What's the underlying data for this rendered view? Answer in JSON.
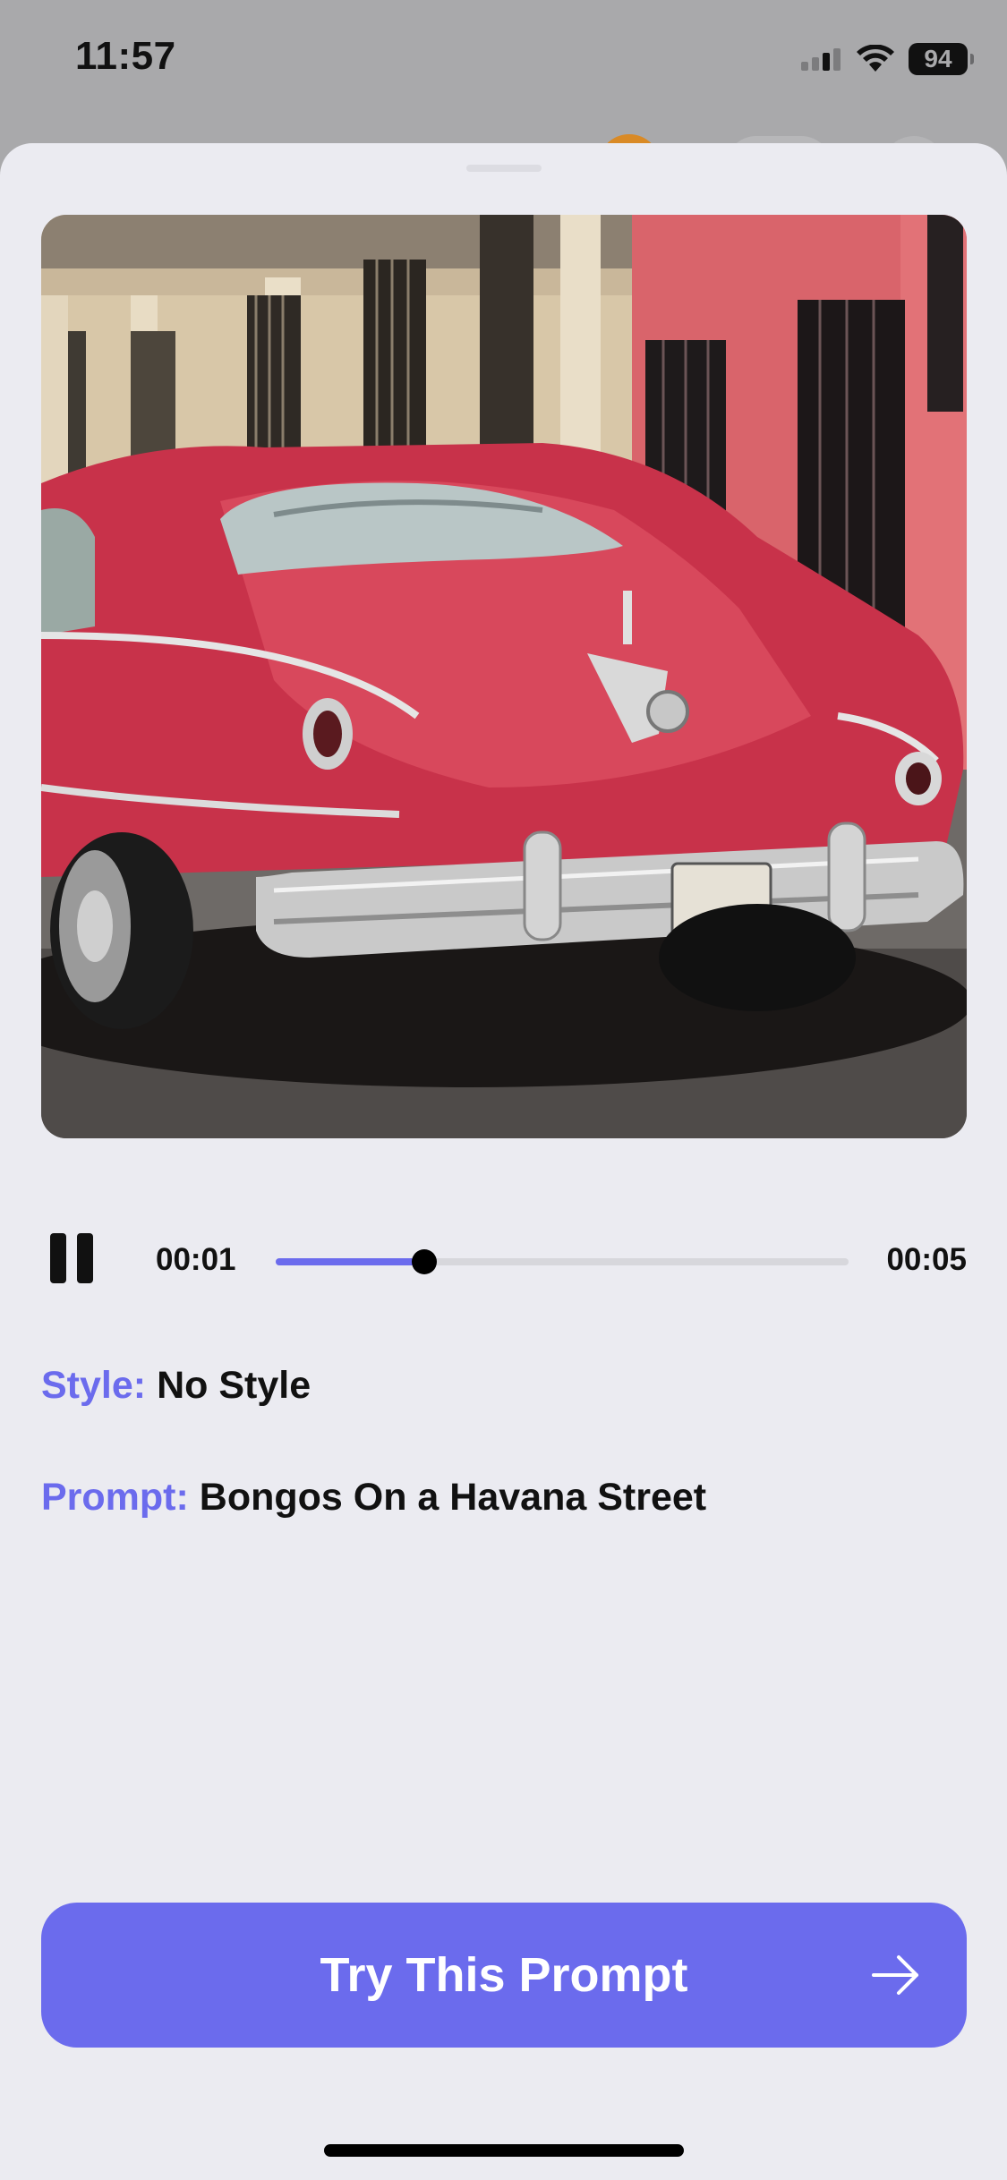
{
  "status_bar": {
    "time": "11:57",
    "battery_level": "94",
    "icons": [
      "cellular-signal-icon",
      "wifi-icon",
      "battery-icon"
    ]
  },
  "sheet": {
    "artwork": {
      "description_icon": "generated-artwork-image"
    },
    "player": {
      "state": "playing",
      "control_icon": "pause-icon",
      "current_time": "00:01",
      "total_time": "00:05",
      "progress_fraction": 0.26
    },
    "style": {
      "label": "Style:",
      "value": "No Style"
    },
    "prompt": {
      "label": "Prompt:",
      "value": "Bongos On a Havana Street"
    },
    "cta": {
      "label": "Try This Prompt",
      "icon": "arrow-right-icon"
    }
  },
  "colors": {
    "accent": "#6b6bed",
    "sheet_background": "#ebebf1",
    "text": "#111111"
  }
}
